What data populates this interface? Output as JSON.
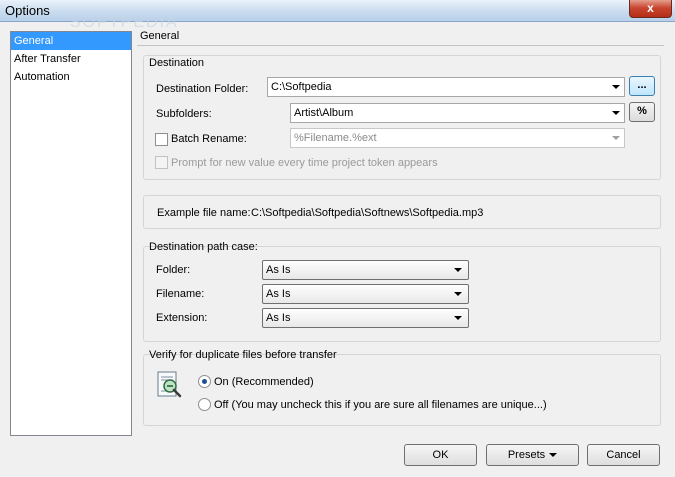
{
  "window": {
    "title": "Options",
    "close_label": "x",
    "watermark": "SOFTPEDIA"
  },
  "sidebar": {
    "items": [
      {
        "label": "General",
        "selected": true
      },
      {
        "label": "After Transfer",
        "selected": false
      },
      {
        "label": "Automation",
        "selected": false
      }
    ]
  },
  "panel": {
    "title": "General"
  },
  "destination": {
    "group_title": "Destination",
    "folder_label": "Destination Folder:",
    "folder_value": "C:\\Softpedia",
    "browse_label": "...",
    "subfolders_label": "Subfolders:",
    "subfolders_value": "Artist\\Album",
    "token_button_label": "%",
    "batch_rename_label": "Batch Rename:",
    "batch_rename_value": "%Filename.%ext",
    "prompt_label": "Prompt for new value every time project token appears"
  },
  "example": {
    "label": "Example file name:",
    "value": "C:\\Softpedia\\Softpedia\\Softnews\\Softpedia.mp3"
  },
  "path_case": {
    "group_title": "Destination path case:",
    "folder_label": "Folder:",
    "folder_value": "As Is",
    "filename_label": "Filename:",
    "filename_value": "As Is",
    "extension_label": "Extension:",
    "extension_value": "As Is"
  },
  "verify": {
    "group_title": "Verify for duplicate files before transfer",
    "on_label": "On (Recommended)",
    "off_label": "Off (You may uncheck this if you are sure all filenames are unique...)"
  },
  "footer": {
    "ok_label": "OK",
    "presets_label": "Presets",
    "cancel_label": "Cancel"
  }
}
